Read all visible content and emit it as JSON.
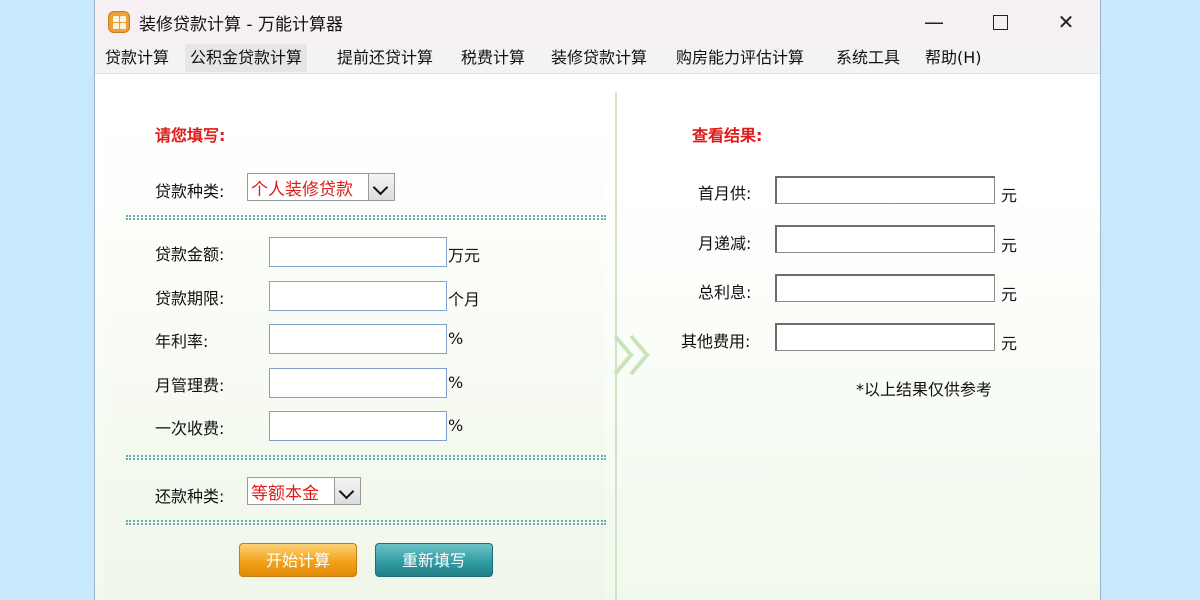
{
  "window": {
    "title": "装修贷款计算 - 万能计算器",
    "controls": {
      "minimize": "—",
      "close": "✕"
    }
  },
  "menu": [
    {
      "label": "贷款计算"
    },
    {
      "label": "公积金贷款计算"
    },
    {
      "label": "提前还贷计算"
    },
    {
      "label": "税费计算"
    },
    {
      "label": "装修贷款计算"
    },
    {
      "label": "购房能力评估计算"
    },
    {
      "label": "系统工具"
    },
    {
      "label": "帮助(H)"
    }
  ],
  "input_section": {
    "title": "请您填写:",
    "loan_type": {
      "label": "贷款种类:",
      "value": "个人装修贷款"
    },
    "fields": [
      {
        "label": "贷款金额:",
        "value": "",
        "unit": "万元"
      },
      {
        "label": "贷款期限:",
        "value": "",
        "unit": "个月"
      },
      {
        "label": "年利率:",
        "value": "",
        "unit": "%"
      },
      {
        "label": "月管理费:",
        "value": "",
        "unit": "%"
      },
      {
        "label": "一次收费:",
        "value": "",
        "unit": "%"
      }
    ],
    "repay_type": {
      "label": "还款种类:",
      "value": "等额本金"
    },
    "buttons": {
      "calculate": "开始计算",
      "reset": "重新填写"
    }
  },
  "result_section": {
    "title": "查看结果:",
    "fields": [
      {
        "label": "首月供:",
        "value": "",
        "unit": "元"
      },
      {
        "label": "月递减:",
        "value": "",
        "unit": "元"
      },
      {
        "label": "总利息:",
        "value": "",
        "unit": "元"
      },
      {
        "label": "其他费用:",
        "value": "",
        "unit": "元"
      }
    ],
    "note": "*以上结果仅供参考"
  },
  "colors": {
    "accent_red": "#e01b1b",
    "calc_button": "#f3a21a",
    "reset_button": "#2e9aa2",
    "divider_green": "#cfe4c5"
  }
}
